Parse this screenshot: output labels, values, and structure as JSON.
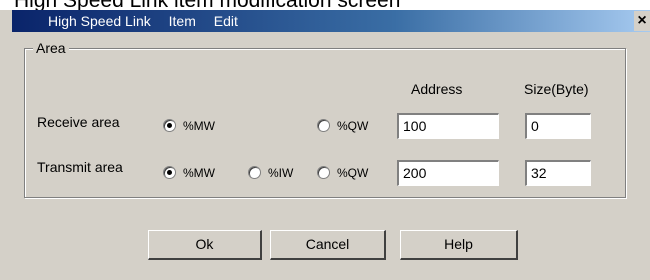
{
  "caption": "High Speed Link item modification screen",
  "titlebar": {
    "menu": [
      "High Speed Link",
      "Item",
      "Edit"
    ],
    "close": "×"
  },
  "area": {
    "group_label": "Area",
    "col_address": "Address",
    "col_size": "Size(Byte)",
    "receive": {
      "label": "Receive area",
      "options": [
        "%MW",
        "%QW"
      ],
      "selected": "%MW",
      "address": "100",
      "size": "0"
    },
    "transmit": {
      "label": "Transmit area",
      "options": [
        "%MW",
        "%IW",
        "%QW"
      ],
      "selected": "%MW",
      "address": "200",
      "size": "32"
    }
  },
  "buttons": {
    "ok": "Ok",
    "cancel": "Cancel",
    "help": "Help"
  }
}
